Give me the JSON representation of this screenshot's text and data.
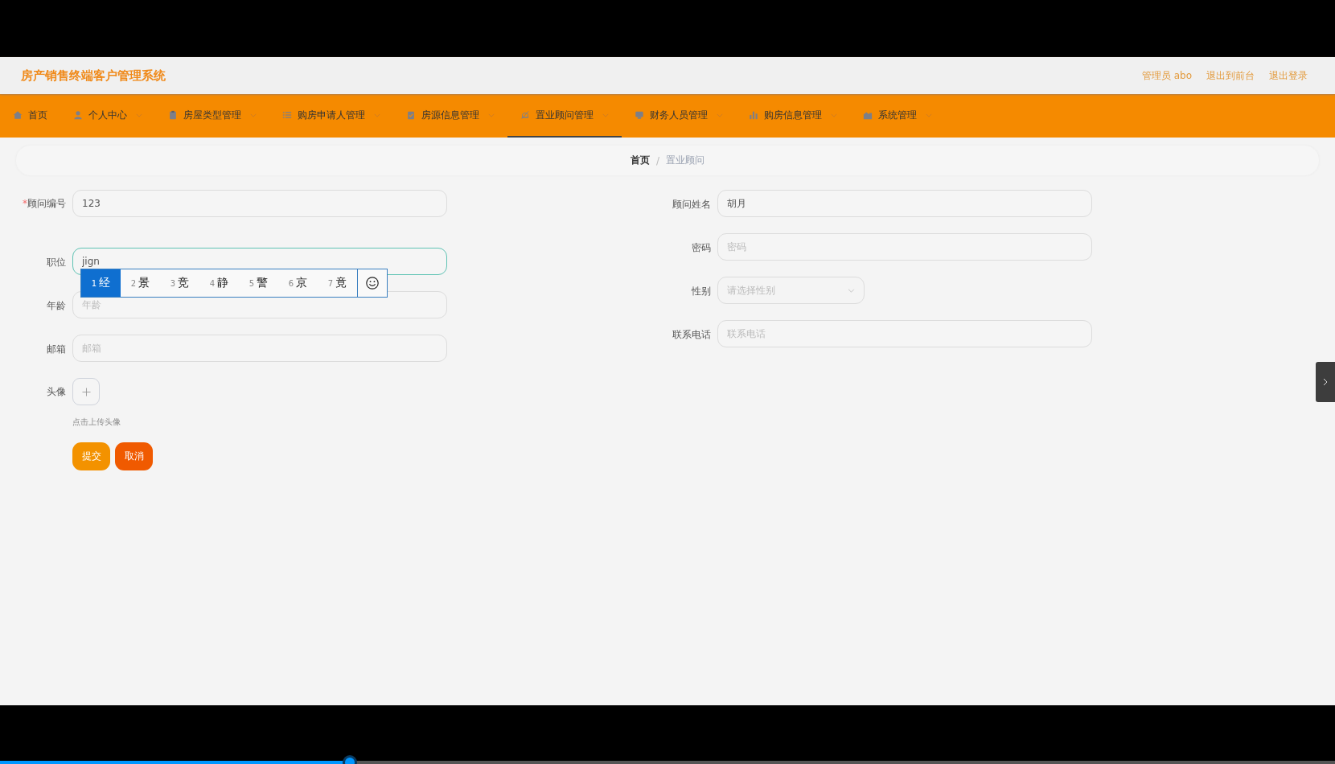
{
  "header": {
    "title": "房产销售终端客户管理系统",
    "links": [
      "管理员 abo",
      "退出到前台",
      "退出登录"
    ]
  },
  "nav": [
    {
      "label": "首页",
      "has_submenu": false,
      "selected": false
    },
    {
      "label": "个人中心",
      "has_submenu": true,
      "selected": false
    },
    {
      "label": "房屋类型管理",
      "has_submenu": true,
      "selected": false
    },
    {
      "label": "购房申请人管理",
      "has_submenu": true,
      "selected": false
    },
    {
      "label": "房源信息管理",
      "has_submenu": true,
      "selected": false
    },
    {
      "label": "置业顾问管理",
      "has_submenu": true,
      "selected": true
    },
    {
      "label": "财务人员管理",
      "has_submenu": true,
      "selected": false
    },
    {
      "label": "购房信息管理",
      "has_submenu": true,
      "selected": false
    },
    {
      "label": "系统管理",
      "has_submenu": true,
      "selected": false
    }
  ],
  "breadcrumb": {
    "items": [
      "首页",
      "置业顾问"
    ],
    "separator": "/"
  },
  "form": {
    "required_mark": "*",
    "left": [
      {
        "label": "顾问编号",
        "kind": "text",
        "required": true,
        "value": "123",
        "focused": false
      },
      {
        "label": "职位",
        "kind": "text",
        "required": false,
        "value": "jign",
        "focused": true
      },
      {
        "label": "年龄",
        "kind": "text",
        "required": false,
        "placeholder": "年龄",
        "focused": false
      },
      {
        "label": "邮箱",
        "kind": "text",
        "required": false,
        "placeholder": "邮箱",
        "focused": false
      },
      {
        "label": "头像",
        "kind": "upload",
        "required": false,
        "hint": "点击上传头像"
      }
    ],
    "right": [
      {
        "label": "顾问姓名",
        "kind": "text",
        "required": false,
        "value": "胡月",
        "focused": false
      },
      {
        "label": "密码",
        "kind": "text",
        "required": false,
        "placeholder": "密码",
        "focused": false
      },
      {
        "label": "性别",
        "kind": "select",
        "required": false,
        "placeholder": "请选择性别",
        "focused": false
      },
      {
        "label": "联系电话",
        "kind": "text",
        "required": false,
        "placeholder": "联系电话",
        "focused": false
      }
    ],
    "buttons": [
      {
        "label": "提交",
        "kind": "primary"
      },
      {
        "label": "取消",
        "kind": "danger"
      }
    ]
  },
  "ime": {
    "candidates": [
      {
        "number": "1",
        "text": "经",
        "selected": true
      },
      {
        "number": "2",
        "text": "景",
        "selected": false
      },
      {
        "number": "3",
        "text": "竞",
        "selected": false
      },
      {
        "number": "4",
        "text": "静",
        "selected": false
      },
      {
        "number": "5",
        "text": "警",
        "selected": false
      },
      {
        "number": "6",
        "text": "京",
        "selected": false
      },
      {
        "number": "7",
        "text": "竟",
        "selected": false
      }
    ]
  },
  "video": {
    "level": 0.262
  }
}
